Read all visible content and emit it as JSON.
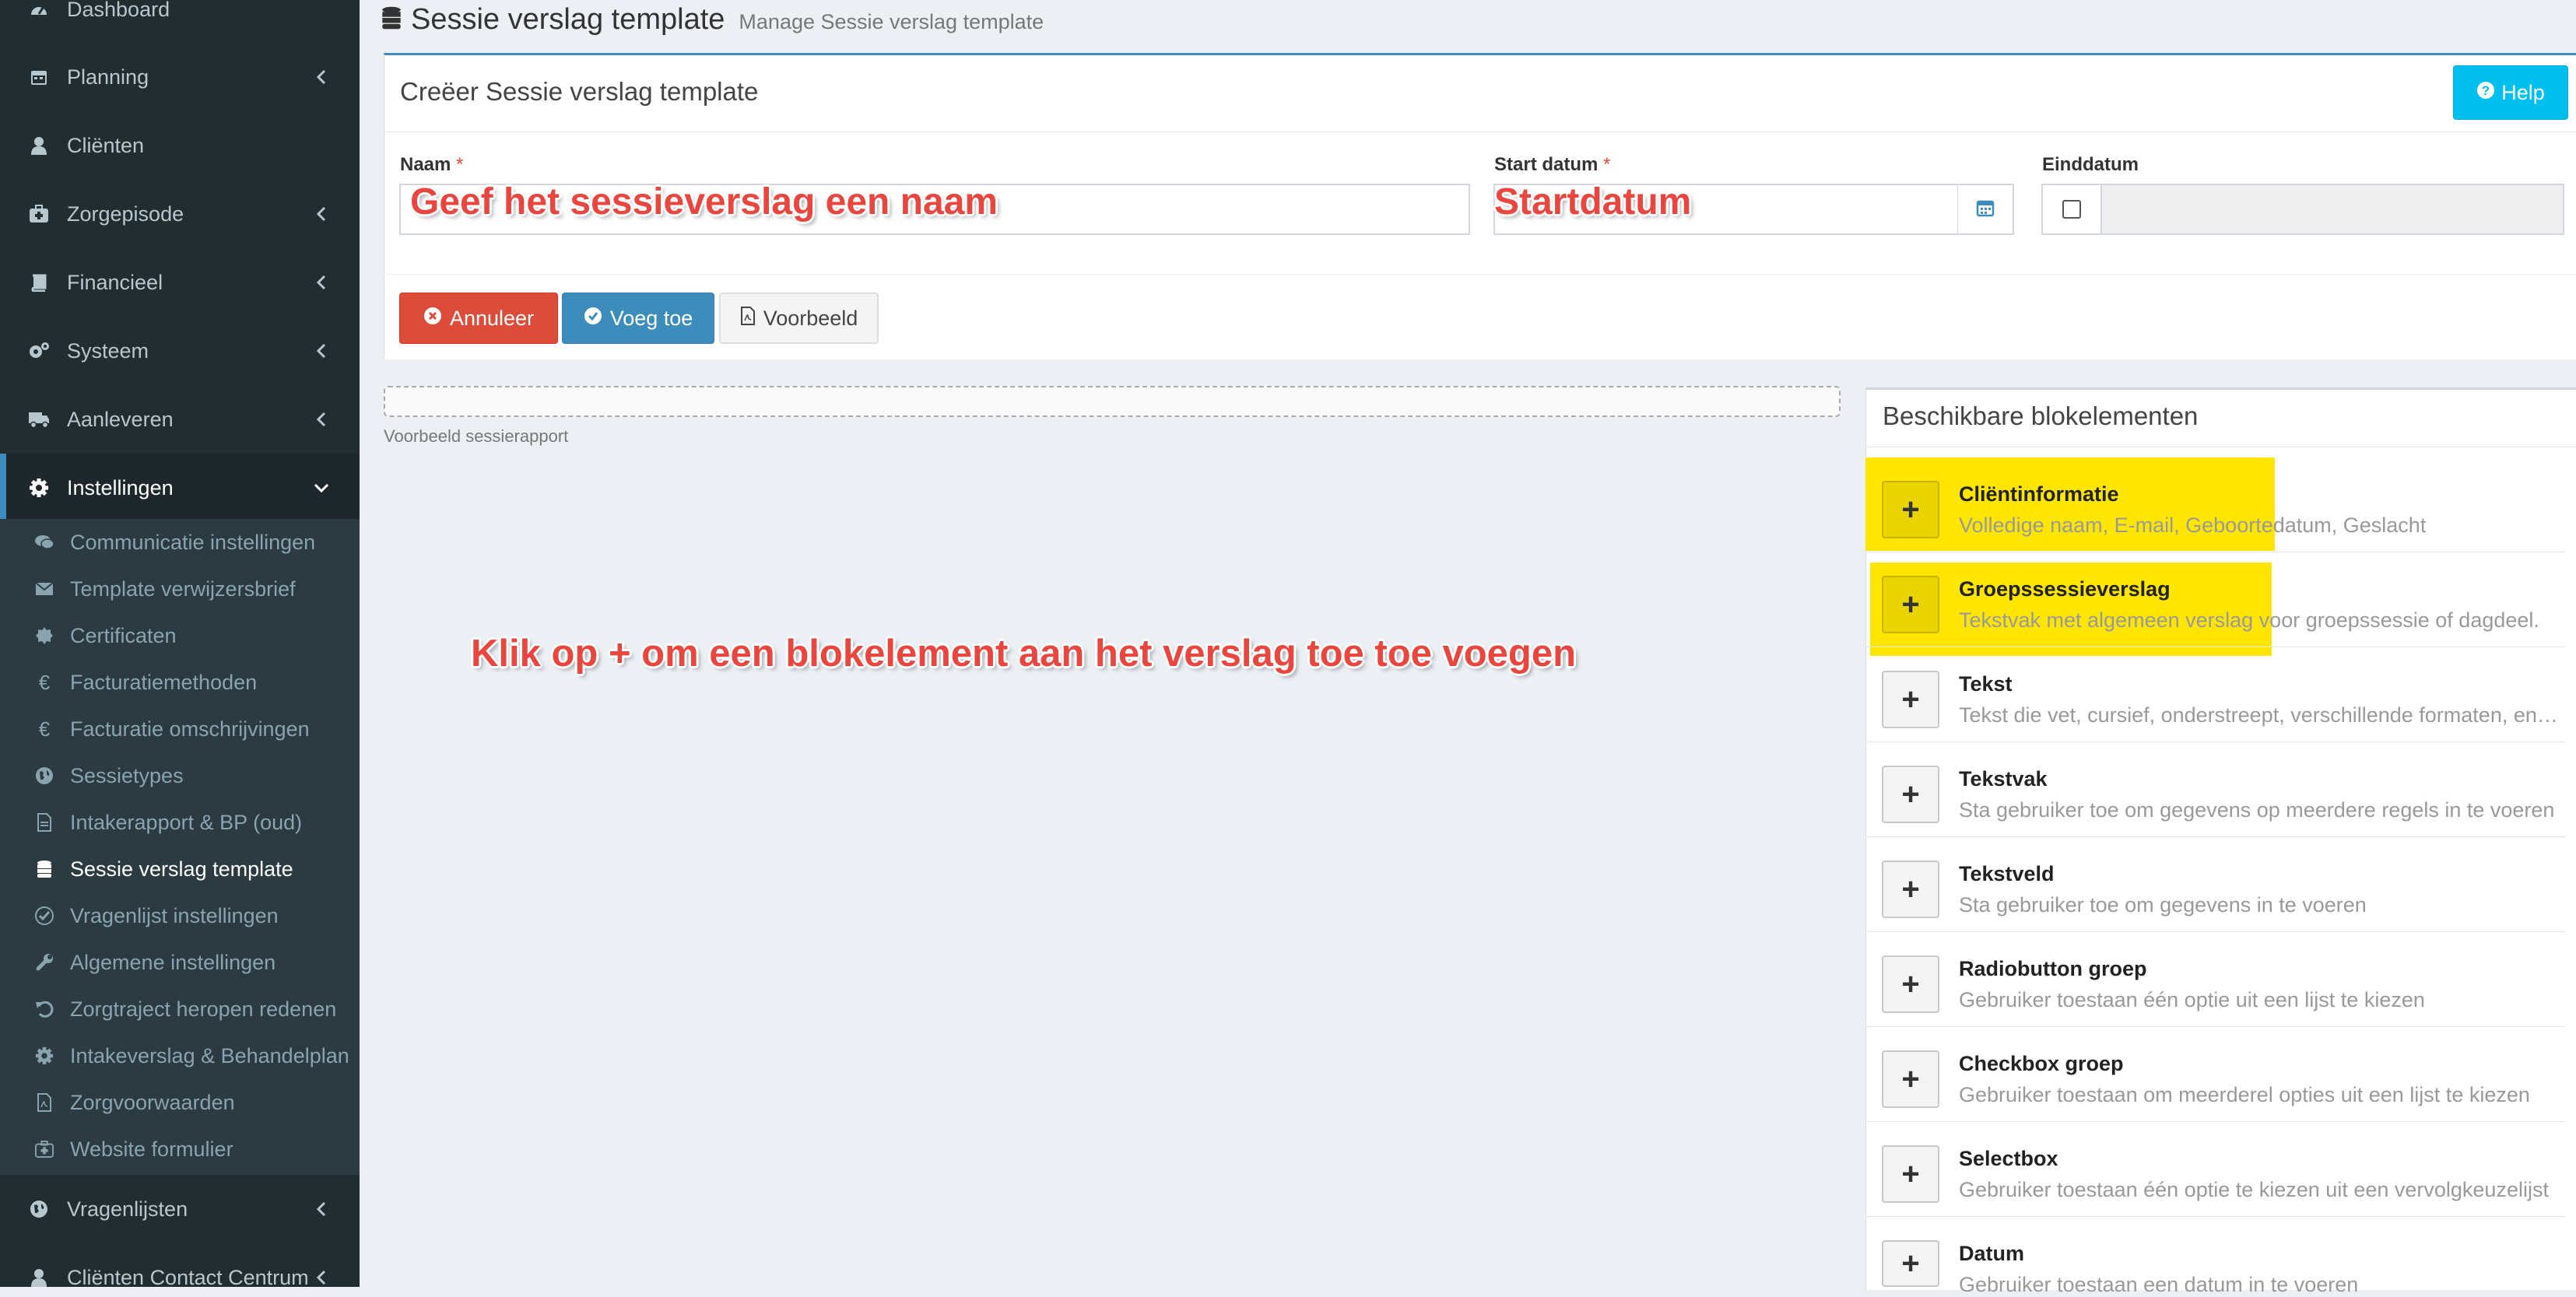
{
  "sidebar": {
    "items": [
      {
        "label": "Dashboard",
        "icon": "dashboard-icon"
      },
      {
        "label": "Planning",
        "icon": "calendar-icon"
      },
      {
        "label": "Cliënten",
        "icon": "user-icon"
      },
      {
        "label": "Zorgepisode",
        "icon": "medkit-icon"
      },
      {
        "label": "Financieel",
        "icon": "book-icon"
      },
      {
        "label": "Systeem",
        "icon": "gears-icon"
      },
      {
        "label": "Aanleveren",
        "icon": "truck-icon"
      },
      {
        "label": "Instellingen",
        "icon": "gear-icon"
      }
    ],
    "submenu": [
      {
        "label": "Communicatie instellingen",
        "icon": "comments-icon"
      },
      {
        "label": "Template verwijzersbrief",
        "icon": "envelope-icon"
      },
      {
        "label": "Certificaten",
        "icon": "certificate-icon"
      },
      {
        "label": "Facturatiemethoden",
        "icon": "euro-icon"
      },
      {
        "label": "Facturatie omschrijvingen",
        "icon": "euro-icon"
      },
      {
        "label": "Sessietypes",
        "icon": "globe-icon"
      },
      {
        "label": "Intakerapport & BP (oud)",
        "icon": "file-icon"
      },
      {
        "label": "Sessie verslag template",
        "icon": "database-icon"
      },
      {
        "label": "Vragenlijst instellingen",
        "icon": "check-circle-icon"
      },
      {
        "label": "Algemene instellingen",
        "icon": "wrench-icon"
      },
      {
        "label": "Zorgtraject heropen redenen",
        "icon": "undo-icon"
      },
      {
        "label": "Intakeverslag & Behandelplan",
        "icon": "gear-icon"
      },
      {
        "label": "Zorgvoorwaarden",
        "icon": "file-pdf-icon"
      },
      {
        "label": "Website formulier",
        "icon": "medkit-icon"
      }
    ],
    "bottom_items": [
      {
        "label": "Vragenlijsten",
        "icon": "globe-icon"
      },
      {
        "label": "Cliënten Contact Centrum",
        "icon": "user-icon"
      }
    ]
  },
  "header": {
    "title": "Sessie verslag template",
    "subtitle": "Manage Sessie verslag template"
  },
  "form": {
    "box_title": "Creëer Sessie verslag template",
    "help_label": "Help",
    "naam_label": "Naam",
    "start_label": "Start datum",
    "eind_label": "Einddatum",
    "required_mark": "*",
    "naam_annotation": "Geef het sessieverslag een naam",
    "start_annotation": "Startdatum",
    "cancel_label": "Annuleer",
    "add_label": "Voeg toe",
    "preview_label": "Voorbeeld"
  },
  "preview": {
    "caption": "Voorbeeld sessierapport",
    "annotation": "Klik op + om een blokelement aan het verslag toe toe voegen"
  },
  "blocks": {
    "title": "Beschikbare blokelementen",
    "plus": "+",
    "items": [
      {
        "name": "Cliëntinformatie",
        "desc": "Volledige naam, E-mail, Geboortedatum, Geslacht"
      },
      {
        "name": "Groepssessieverslag",
        "desc": "Tekstvak met algemeen verslag voor groepssessie of dagdeel."
      },
      {
        "name": "Tekst",
        "desc": "Tekst die vet, cursief, onderstreept, verschillende formaten, enz. kan worden weergegeven"
      },
      {
        "name": "Tekstvak",
        "desc": "Sta gebruiker toe om gegevens op meerdere regels in te voeren"
      },
      {
        "name": "Tekstveld",
        "desc": "Sta gebruiker toe om gegevens in te voeren"
      },
      {
        "name": "Radiobutton groep",
        "desc": "Gebruiker toestaan één optie uit een lijst te kiezen"
      },
      {
        "name": "Checkbox groep",
        "desc": "Gebruiker toestaan om meerderel opties uit een lijst te kiezen"
      },
      {
        "name": "Selectbox",
        "desc": "Gebruiker toestaan één optie te kiezen uit een vervolgkeuzelijst"
      },
      {
        "name": "Datum",
        "desc": "Gebruiker toestaan een datum in te voeren"
      }
    ]
  },
  "colors": {
    "sidebar_bg": "#222d32",
    "accent": "#3c8dbc",
    "danger": "#dd4b39",
    "info": "#00c0ef",
    "highlight": "#ffe600",
    "annotation": "#e8463e"
  }
}
